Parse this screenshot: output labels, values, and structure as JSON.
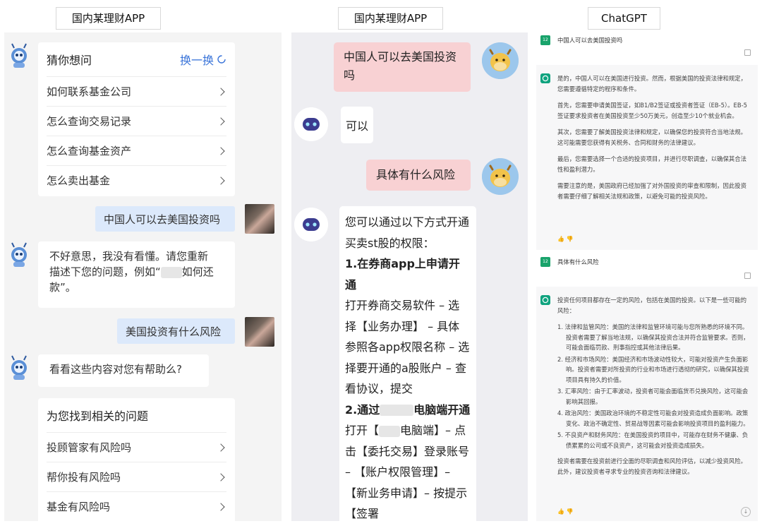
{
  "captions": [
    "国内某理财APP",
    "国内某理财APP",
    "ChatGPT"
  ],
  "panel1": {
    "guess": {
      "title": "猜你想问",
      "swap": "换一换",
      "items": [
        "如何联系基金公司",
        "怎么查询交易记录",
        "怎么查询基金资产",
        "怎么卖出基金"
      ]
    },
    "user_msg1": "中国人可以去美国投资吗",
    "bot_reply1": [
      "不好意思，我没有看懂。请您重新",
      "描述下您的问题，例如“",
      "如何还",
      "款”。"
    ],
    "user_msg2": "美国投资有什么风险",
    "bot_reply2": "看看这些内容对您有帮助么?",
    "related": {
      "title": "为您找到相关的问题",
      "items": [
        "投顾管家有风险吗",
        "帮你投有风险吗",
        "基金有风险吗"
      ]
    }
  },
  "panel2": {
    "user_msg1": "中国人可以去美国投资吗",
    "bot_reply1": "可以",
    "user_msg2": "具体有什么风险",
    "long_reply": {
      "intro": "您可以通过以下方式开通买卖st股的权限：",
      "step1_title": "1.在券商app上申请开通",
      "step1_body": "打开券商交易软件 – 选择【业务办理】 – 具体参照各app权限名称 – 选择要开通的a股账户 – 查看协议，提交",
      "step2_title_a": "2.通过",
      "step2_title_b": "电脑端开通",
      "step2_body_a": "打开【",
      "step2_body_b": "电脑端】– 点击【委托交易】登录账号 – 【账户权限管理】– 【新业务申请】– 按提示【签署"
    }
  },
  "panel3": {
    "q1": "中国人可以去美国投资吗",
    "a1": [
      "是的，中国人可以在美国进行投资。然而，根据美国的投资法律和规定，您需要遵循特定的程序和条件。",
      "首先，您需要申请美国签证，如B1/B2签证或投资者签证（EB-5）。EB-5签证要求投资者在美国投资至少50万美元，创造至少10个就业机会。",
      "其次，您需要了解美国投资法律和规定，以确保您的投资符合当地法规。这可能需要您获得有关税务、合同和财务的法律建议。",
      "最后，您需要选择一个合适的投资项目，并进行尽职调查，以确保其合法性和盈利潜力。",
      "需要注意的是，美国政府已经加强了对外国投资的审查和限制，因此投资者需要仔细了解相关法规和政策，以避免可能的投资风险。"
    ],
    "q2": "具体有什么风险",
    "a2_intro": "投资任何项目都存在一定的风险，包括在美国的投资。以下是一些可能的风险：",
    "a2_items": [
      "1. 法律和监管风险：美国的法律和监管环境可能与您所熟悉的环境不同。投资者需要了解当地法规，以确保其投资合法并符合监管要求。否则，可能会面临罚款、刑事指控或其他法律后果。",
      "2. 经济和市场风险：美国经济和市场波动性较大，可能对投资产生负面影响。投资者需要对所投资的行业和市场进行透彻的研究，以确保其投资项目具有持久的价值。",
      "3. 汇率风险：由于汇率波动，投资者可能会面临货币兑换风险，这可能会影响其回报。",
      "4. 政治风险：美国政治环境的不稳定性可能会对投资造成负面影响。政策变化、政治不确定性、贸易战等因素可能会影响投资项目的盈利能力。",
      "5. 不良资产和财务风险：在美国投资的项目中，可能存在财务不健康、负债累累的公司或不良资产，这可能会对投资造成损失。"
    ],
    "a2_outro": "投资者需要在投资前进行全面的尽职调查和风险评估，以减少投资风险。此外，建议投资者寻求专业的投资咨询和法律建议。",
    "user_badge": "12"
  }
}
